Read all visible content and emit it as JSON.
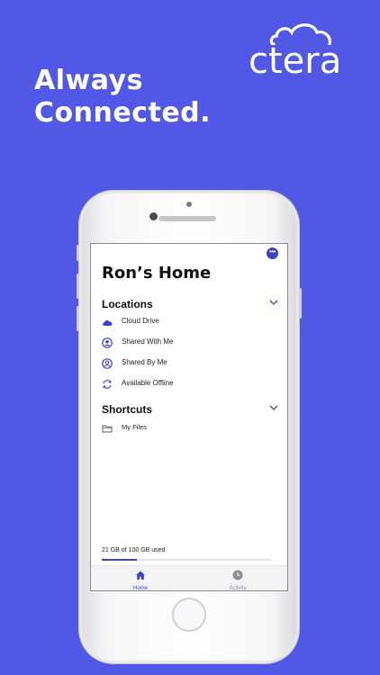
{
  "brand": {
    "logo_text": "ctera"
  },
  "headline": {
    "line1": "Always",
    "line2": "Connected."
  },
  "colors": {
    "background": "#5158E6",
    "accent": "#3C43C8"
  },
  "app": {
    "more_icon": "more-icon",
    "more_glyph": "•••",
    "title": "Ron’s Home",
    "locations": {
      "heading": "Locations",
      "items": [
        {
          "label": "Cloud Drive",
          "icon": "cloud-icon"
        },
        {
          "label": "Shared With Me",
          "icon": "shared-with-me-icon"
        },
        {
          "label": "Shared By Me",
          "icon": "shared-by-me-icon"
        },
        {
          "label": "Available Offline",
          "icon": "sync-icon"
        }
      ]
    },
    "shortcuts": {
      "heading": "Shortcuts",
      "items": [
        {
          "label": "My Files",
          "icon": "folder-icon"
        }
      ]
    },
    "storage": {
      "text": "21 GB of 100 GB used",
      "used_fraction": 0.21
    },
    "tabs": [
      {
        "label": "Home",
        "icon": "home-icon",
        "active": true
      },
      {
        "label": "Activity",
        "icon": "clock-icon",
        "active": false
      }
    ]
  }
}
